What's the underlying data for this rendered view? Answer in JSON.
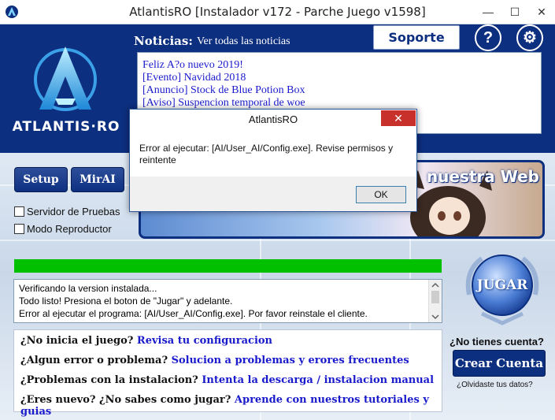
{
  "window": {
    "title": "AtlantisRO [Instalador v172 - Parche Juego v1598]",
    "minimize": "—",
    "maximize": "☐",
    "close": "✕"
  },
  "logo": {
    "text": "ATLANTIS·RO"
  },
  "news": {
    "label": "Noticias:",
    "all_link": "Ver todas las noticias",
    "items": [
      "Feliz A?o nuevo 2019!",
      "[Evento] Navidad 2018",
      "[Anuncio] Stock de Blue Potion Box",
      "[Aviso] Suspencion temporal de woe"
    ]
  },
  "toolbar": {
    "support": "Soporte",
    "help": "?",
    "settings": "⚙"
  },
  "buttons": {
    "setup": "Setup",
    "mirai": "MirAI"
  },
  "options": {
    "test_server": "Servidor de Pruebas",
    "player_mode": "Modo Reproductor"
  },
  "banner": {
    "text": "nuestra Web"
  },
  "log": {
    "lines": [
      "Verificando la version instalada...",
      "Todo listo! Presiona el boton de \"Jugar\" y adelante.",
      "Error al ejecutar el programa: [AI/User_AI/Config.exe]. Por favor reinstale el cliente."
    ]
  },
  "help_links": [
    {
      "question": "¿No inicia el juego?",
      "link": "Revisa tu configuracion"
    },
    {
      "question": "¿Algun error o problema?",
      "link": "Solucion a problemas y erores frecuentes"
    },
    {
      "question": "¿Problemas con la instalacion?",
      "link": "Intenta la descarga / instalacion manual"
    },
    {
      "question": "¿Eres nuevo? ¿No sabes como jugar?",
      "link": "Aprende con nuestros tutoriales y guias"
    }
  ],
  "play": {
    "label": "JUGAR"
  },
  "account": {
    "prompt": "¿No tienes cuenta?",
    "create": "Crear Cuenta",
    "forgot": "¿Olvidaste tus datos?"
  },
  "dialog": {
    "title": "AtlantisRO",
    "close": "✕",
    "message": "Error al ejecutar: [AI/User_AI/Config.exe]. Revise permisos y reintente",
    "ok": "OK"
  },
  "colors": {
    "brand": "#0d2f80",
    "progress": "#00c000",
    "link": "#1a1acd"
  },
  "progress": {
    "percent": 100
  }
}
